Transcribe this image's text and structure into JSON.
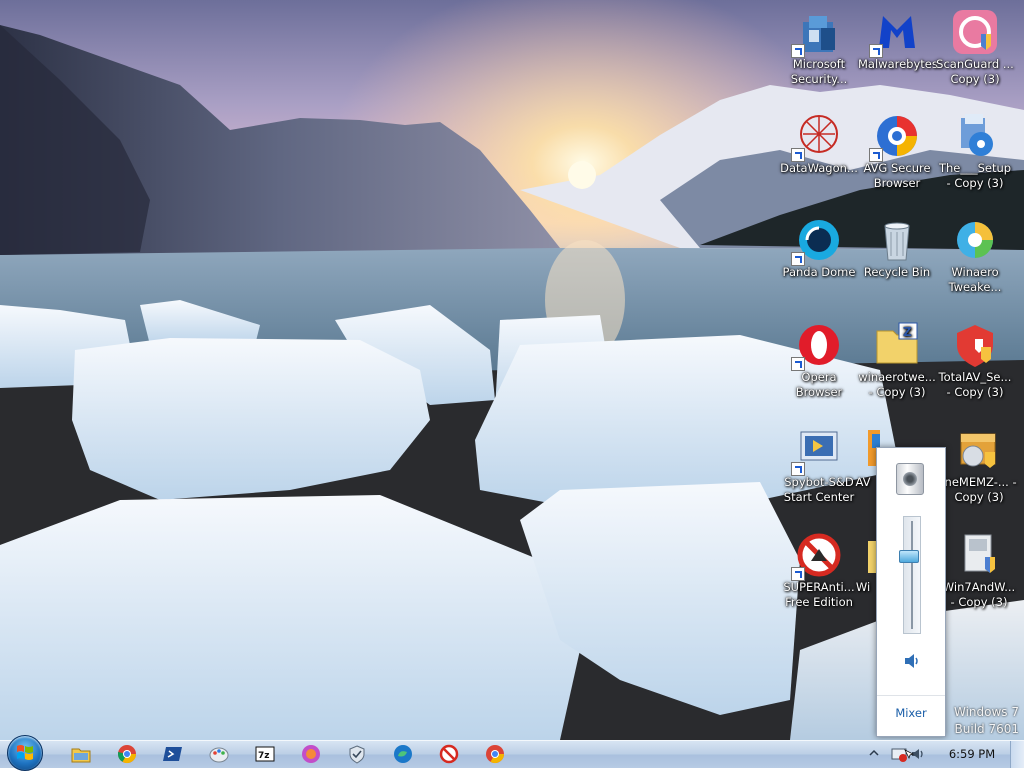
{
  "desktop": {
    "icons": [
      {
        "label": "Microsoft Security...",
        "icon": "microsoft-security-essentials"
      },
      {
        "label": "Malwarebytes",
        "icon": "malwarebytes"
      },
      {
        "label": "ScanGuard ... Copy (3)",
        "icon": "scanguard"
      },
      {
        "label": "DataWagon...",
        "icon": "datawagon"
      },
      {
        "label": "AVG Secure Browser",
        "icon": "avg-secure-browser"
      },
      {
        "label": "The___Setup - Copy (3)",
        "icon": "setup-installer"
      },
      {
        "label": "Panda Dome",
        "icon": "panda-dome"
      },
      {
        "label": "Recycle Bin",
        "icon": "recycle-bin"
      },
      {
        "label": "Winaero Tweake...",
        "icon": "winaero-tweaker"
      },
      {
        "label": "Opera Browser",
        "icon": "opera"
      },
      {
        "label": "winaerotwe... - Copy (3)",
        "icon": "zip-folder"
      },
      {
        "label": "TotalAV_Se... - Copy (3)",
        "icon": "totalav"
      },
      {
        "label": "Spybot-S&D Start Center",
        "icon": "spybot"
      },
      {
        "label": "AV",
        "icon": "av-software"
      },
      {
        "label": "ineMEMZ-... - Copy (3)",
        "icon": "package"
      },
      {
        "label": "SUPERAnti... Free Edition",
        "icon": "superantispyware"
      },
      {
        "label": "Wi",
        "icon": "folder"
      },
      {
        "label": "Win7AndW... - Copy (3)",
        "icon": "installer"
      }
    ]
  },
  "volume_flyout": {
    "level_percent": 70,
    "mixer_label": "Mixer"
  },
  "watermark": {
    "line1": "Windows 7",
    "line2": "Build 7601"
  },
  "taskbar": {
    "pinned": [
      "file-explorer",
      "chrome",
      "powershell",
      "paint",
      "7-zip",
      "firefox-like",
      "windows-defender",
      "edge",
      "superantispyware",
      "chrome-2"
    ],
    "clock": "6:59 PM"
  },
  "colors": {
    "taskbar": "#bccfe6",
    "mixer_link": "#1a5ea8",
    "start_orb": "#1f74c2"
  }
}
